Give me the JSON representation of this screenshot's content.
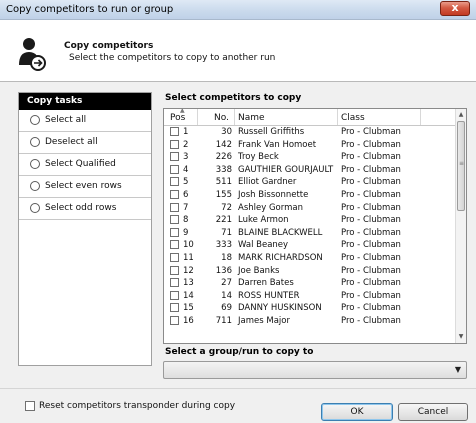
{
  "window": {
    "title": "Copy competitors to run or group",
    "close_glyph": "x"
  },
  "header": {
    "title": "Copy competitors",
    "subtitle": "Select the competitors to copy to another run",
    "icon": "person-copy-icon"
  },
  "tasks": {
    "heading": "Copy tasks",
    "items": [
      {
        "label": "Select all"
      },
      {
        "label": "Deselect all"
      },
      {
        "label": "Select Qualified"
      },
      {
        "label": "Select even rows"
      },
      {
        "label": "Select odd rows"
      }
    ]
  },
  "competitors": {
    "heading": "Select competitors to copy",
    "columns": [
      "Pos",
      "No.",
      "Name",
      "Class"
    ],
    "rows": [
      {
        "pos": "1",
        "no": "30",
        "name": "Russell Griffiths",
        "class": "Pro - Clubman"
      },
      {
        "pos": "2",
        "no": "142",
        "name": "Frank Van Homoet",
        "class": "Pro - Clubman"
      },
      {
        "pos": "3",
        "no": "226",
        "name": "Troy Beck",
        "class": "Pro - Clubman"
      },
      {
        "pos": "4",
        "no": "338",
        "name": "GAUTHIER GOURJAULT",
        "class": "Pro - Clubman"
      },
      {
        "pos": "5",
        "no": "511",
        "name": "Elliot Gardner",
        "class": "Pro - Clubman"
      },
      {
        "pos": "6",
        "no": "155",
        "name": "Josh Bissonnette",
        "class": "Pro - Clubman"
      },
      {
        "pos": "7",
        "no": "72",
        "name": "Ashley Gorman",
        "class": "Pro - Clubman"
      },
      {
        "pos": "8",
        "no": "221",
        "name": "Luke Armon",
        "class": "Pro - Clubman"
      },
      {
        "pos": "9",
        "no": "71",
        "name": "BLAINE BLACKWELL",
        "class": "Pro - Clubman"
      },
      {
        "pos": "10",
        "no": "333",
        "name": "Wal Beaney",
        "class": "Pro - Clubman"
      },
      {
        "pos": "11",
        "no": "18",
        "name": "MARK RICHARDSON",
        "class": "Pro - Clubman"
      },
      {
        "pos": "12",
        "no": "136",
        "name": "Joe Banks",
        "class": "Pro - Clubman"
      },
      {
        "pos": "13",
        "no": "27",
        "name": "Darren Bates",
        "class": "Pro - Clubman"
      },
      {
        "pos": "14",
        "no": "14",
        "name": "ROSS HUNTER",
        "class": "Pro - Clubman"
      },
      {
        "pos": "15",
        "no": "69",
        "name": "DANNY HUSKINSON",
        "class": "Pro - Clubman"
      },
      {
        "pos": "16",
        "no": "711",
        "name": "James Major",
        "class": "Pro - Clubman"
      }
    ]
  },
  "target": {
    "heading": "Select a group/run to copy to",
    "value": ""
  },
  "footer": {
    "reset_label": "Reset competitors transponder during copy",
    "ok_label": "OK",
    "cancel_label": "Cancel"
  }
}
